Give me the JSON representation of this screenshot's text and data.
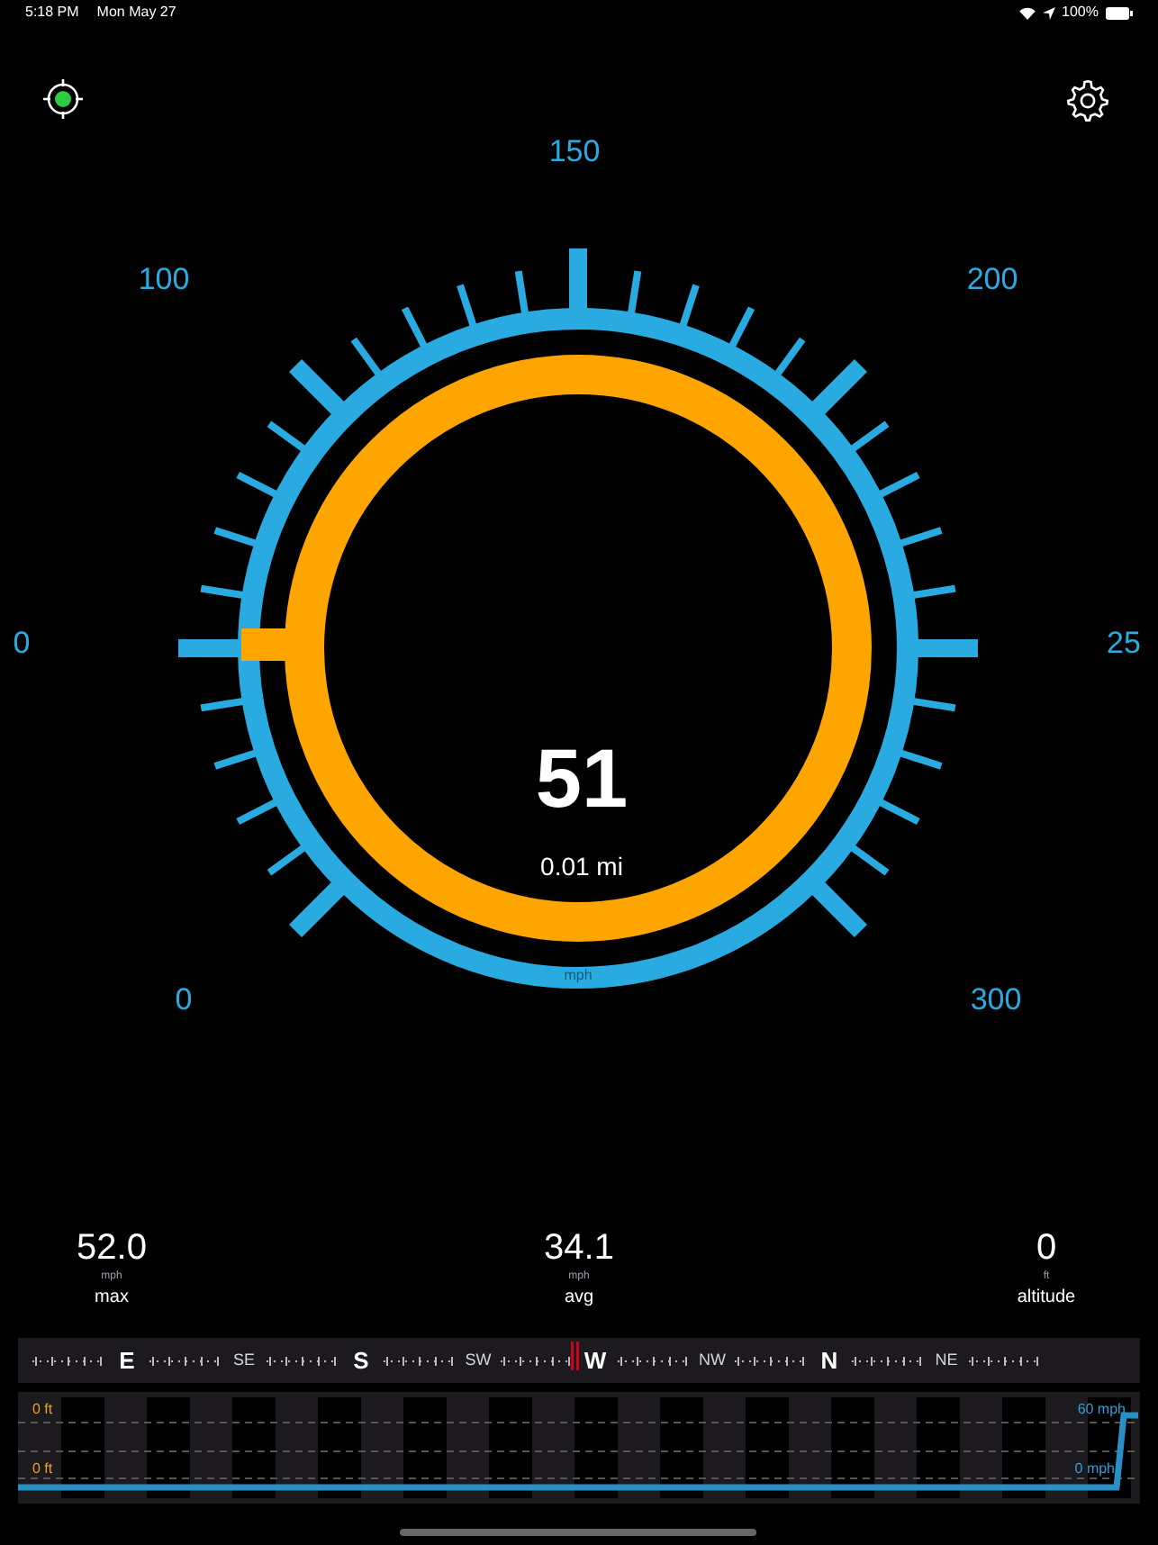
{
  "status_bar": {
    "time": "5:18 PM",
    "date": "Mon May 27",
    "battery": "100%"
  },
  "toolbar": {
    "gps_fix": true
  },
  "gauge": {
    "labels": [
      {
        "text": "0"
      },
      {
        "text": "0"
      },
      {
        "text": "100"
      },
      {
        "text": "150"
      },
      {
        "text": "200"
      },
      {
        "text": "25"
      },
      {
        "text": "300"
      }
    ],
    "speed": "51",
    "distance": "0.01 mi",
    "unit": "mph"
  },
  "stats": [
    {
      "value": "52.0",
      "unit": "mph",
      "label": "max"
    },
    {
      "value": "34.1",
      "unit": "mph",
      "label": "avg"
    },
    {
      "value": "0",
      "unit": "ft",
      "label": "altitude"
    }
  ],
  "compass": [
    {
      "label": "E",
      "kind": "cardinal",
      "selected": false
    },
    {
      "label": "SE",
      "kind": "intercardinal",
      "selected": false
    },
    {
      "label": "S",
      "kind": "cardinal",
      "selected": false
    },
    {
      "label": "SW",
      "kind": "intercardinal",
      "selected": false
    },
    {
      "label": "W",
      "kind": "cardinal",
      "selected": true
    },
    {
      "label": "NW",
      "kind": "intercardinal",
      "selected": false
    },
    {
      "label": "N",
      "kind": "cardinal",
      "selected": false
    },
    {
      "label": "NE",
      "kind": "intercardinal",
      "selected": false
    }
  ],
  "history": {
    "altitude_top": "0 ft",
    "altitude_bottom": "0 ft",
    "speed_top": "60 mph",
    "speed_bottom": "0 mph"
  }
}
